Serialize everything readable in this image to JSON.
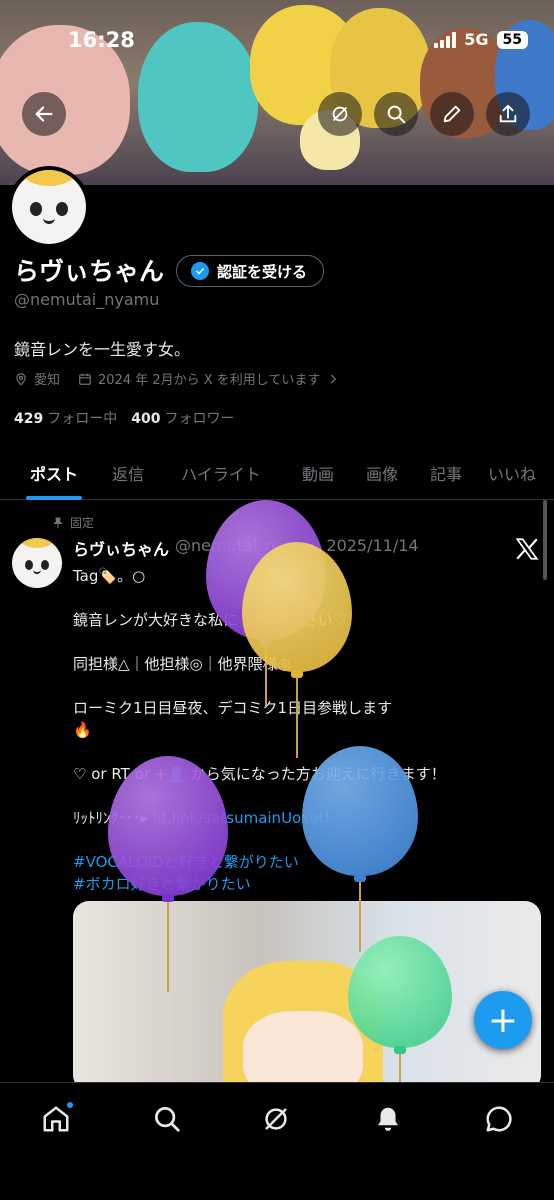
{
  "status_bar": {
    "time": "16:28",
    "network": "5G",
    "battery": "55"
  },
  "header": {
    "back_icon": "arrow-left-icon",
    "grok_icon": "grok-icon",
    "search_icon": "search-icon",
    "edit_icon": "pencil-icon",
    "share_icon": "share-icon"
  },
  "profile": {
    "name": "らヴぃちゃん",
    "verify_button": "認証を受ける",
    "handle": "@nemutai_nyamu",
    "bio": "鏡音レンを一生愛す女。",
    "location": "愛知",
    "joined": "2024 年 2月から X を利用しています",
    "following_count": "429",
    "following_label": "フォロー中",
    "followers_count": "400",
    "followers_label": "フォロワー"
  },
  "tabs": [
    "ポスト",
    "返信",
    "ハイライト",
    "動画",
    "画像",
    "記事",
    "いいね"
  ],
  "active_tab": "ポスト",
  "post": {
    "pinned_label": "固定",
    "author": "らヴぃちゃん",
    "handle": "@nemutai_nyamu",
    "date": "2025/11/14",
    "line1": "Tag🏷️。○",
    "line2": "鏡音レンが大好きな私に お届け下さい♡",
    "line3": "同担様△｜他担様◎｜他界隈様◎",
    "line4": "ローミク1日目昼夜、デコミク1日目参戦します",
    "line4b": "🔥",
    "line5": "♡ or RT or +👤 から気になった方お迎えに行きます！",
    "link_prefix": "ﾘｯﾄﾘﾝｸ･･･▸",
    "link": "lit.link/satsumainUoxoU",
    "hashtag1": "#VOCALOIDと好きと繋がりたい",
    "hashtag2": "#ボカロ好きと繋がりたい"
  },
  "fab_label": "+",
  "bottom_nav": {
    "home_icon": "home-icon",
    "search_icon": "search-icon",
    "grok_icon": "grok-icon",
    "notifications_icon": "bell-icon",
    "messages_icon": "message-icon"
  },
  "colors": {
    "accent": "#1d9bf0",
    "background": "#000000",
    "muted": "#71767b"
  }
}
